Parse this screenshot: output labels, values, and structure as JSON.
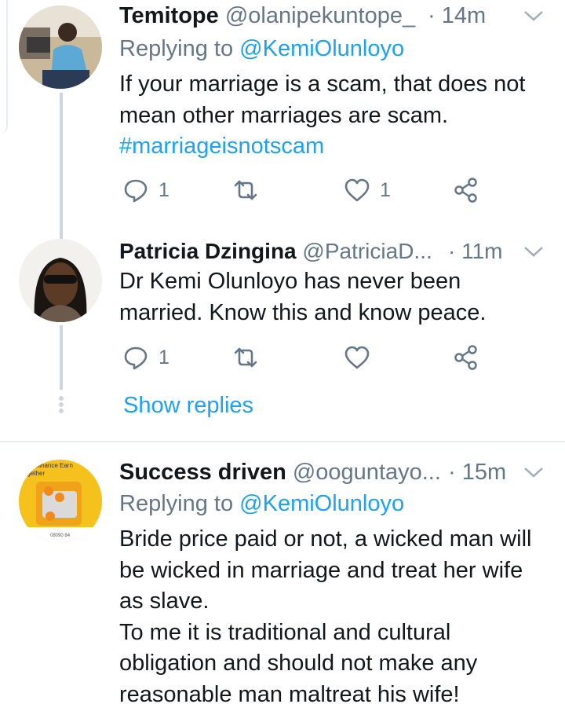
{
  "tweets": [
    {
      "name": "Temitope",
      "handle": "@olanipekuntope_",
      "time": "· 14m",
      "replying_prefix": "Replying to ",
      "replying_to": "@KemiOlunloyo",
      "text_line1": "If your marriage is a scam, that does not",
      "text_line2": "mean other marriages are scam.",
      "hashtag": "#marriageisnotscam",
      "reply_count": "1",
      "retweet_count": "",
      "like_count": "1"
    },
    {
      "name": "Patricia Dzingina",
      "handle": "@PatriciaD...",
      "time": "· 11m",
      "text_line1": "Dr Kemi Olunloyo has never been",
      "text_line2": "married. Know this and know peace.",
      "reply_count": "1",
      "retweet_count": "",
      "like_count": ""
    },
    {
      "name": "Success driven",
      "handle": "@ooguntayo...",
      "time": "· 15m",
      "replying_prefix": "Replying to ",
      "replying_to": "@KemiOlunloyo",
      "text_line1": "Bride price paid or not, a wicked man will",
      "text_line2": "be wicked in marriage and treat her wife",
      "text_line3": "as slave.",
      "text_line4": "To me it is traditional and cultural",
      "text_line5": "obligation and should not make any",
      "text_line6": "reasonable man maltreat his wife!",
      "avatar_text_top": "elinance Earn",
      "avatar_text_top2": "ogether",
      "avatar_text_bottom": "08090 84"
    }
  ],
  "show_replies_label": "Show replies",
  "colors": {
    "accent": "#1da1f2",
    "muted": "#657786",
    "line": "#ccd6dd"
  },
  "icons": [
    "reply-icon",
    "retweet-icon",
    "like-icon",
    "share-icon",
    "chevron-down-icon"
  ]
}
